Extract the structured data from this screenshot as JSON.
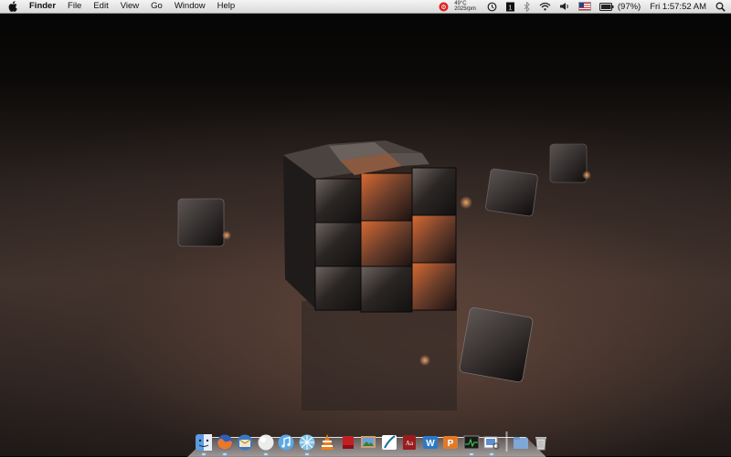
{
  "menubar": {
    "app_name": "Finder",
    "menus": [
      "File",
      "Edit",
      "View",
      "Go",
      "Window",
      "Help"
    ],
    "status": {
      "temperature": "49°C",
      "fan_speed": "2025rpm",
      "battery": "(97%)",
      "clock": "Fri 1:57:52 AM",
      "icons": [
        "cpu-monitor-icon",
        "time-machine-icon",
        "istat-icon",
        "bluetooth-icon",
        "wifi-icon",
        "volume-icon",
        "us-flag-input-icon",
        "battery-icon",
        "spotlight-icon"
      ]
    }
  },
  "dock": {
    "items": [
      {
        "name": "finder",
        "running": true
      },
      {
        "name": "firefox",
        "running": true
      },
      {
        "name": "thunderbird",
        "running": false
      },
      {
        "name": "safari-ball",
        "running": true
      },
      {
        "name": "itunes",
        "running": false
      },
      {
        "name": "network-utility",
        "running": true
      },
      {
        "name": "vlc",
        "running": false
      },
      {
        "name": "front-row",
        "running": false
      },
      {
        "name": "iphoto",
        "running": false
      },
      {
        "name": "quill-app",
        "running": false
      },
      {
        "name": "dictionary",
        "running": false
      },
      {
        "name": "word",
        "running": false
      },
      {
        "name": "powerpoint",
        "running": false
      },
      {
        "name": "activity-monitor",
        "running": true
      },
      {
        "name": "preview",
        "running": true
      },
      {
        "name": "documents-stack",
        "running": false
      },
      {
        "name": "trash",
        "running": false
      }
    ]
  },
  "colors": {
    "menubar_top": "#f4f4f4",
    "menubar_bottom": "#d9d9d9",
    "wallpaper_accent": "#e0733a"
  }
}
